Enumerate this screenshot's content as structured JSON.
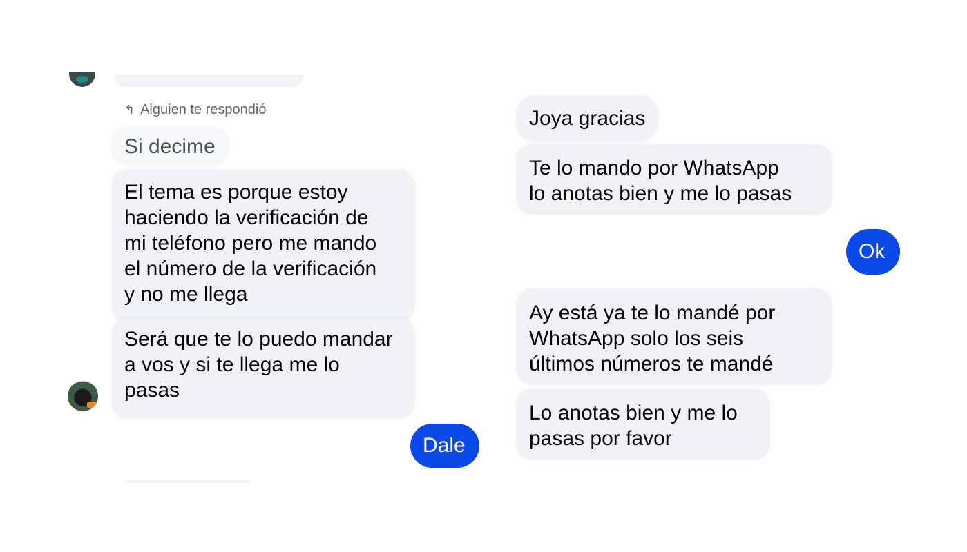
{
  "left_chat": {
    "reply_note": "Alguien te respondió",
    "messages": [
      {
        "lines": [
          "Si decime"
        ]
      },
      {
        "lines": [
          "El tema es porque estoy",
          "haciendo la verificación de",
          "mi teléfono pero me mando",
          "el número de la verificación",
          "y no me llega"
        ]
      },
      {
        "lines": [
          "Será que te lo puedo mandar",
          "a vos  y si te llega me lo",
          "pasas"
        ]
      }
    ],
    "my_reply": "Dale"
  },
  "right_chat": {
    "messages": [
      {
        "lines": [
          "Joya gracias"
        ]
      },
      {
        "lines": [
          "Te lo mando por WhatsApp",
          "lo anotas bien y me lo pasas"
        ]
      }
    ],
    "my_reply": "Ok",
    "messages_after": [
      {
        "lines": [
          "Ay está ya te lo mandé por",
          "WhatsApp solo los seis",
          "últimos números te mandé"
        ]
      },
      {
        "lines": [
          "Lo anotas bien y me lo",
          "pasas por favor"
        ]
      }
    ]
  },
  "colors": {
    "sent_bubble": "#0a48e8",
    "received_bubble": "#f0f2f5",
    "muted_text": "#65676b"
  }
}
